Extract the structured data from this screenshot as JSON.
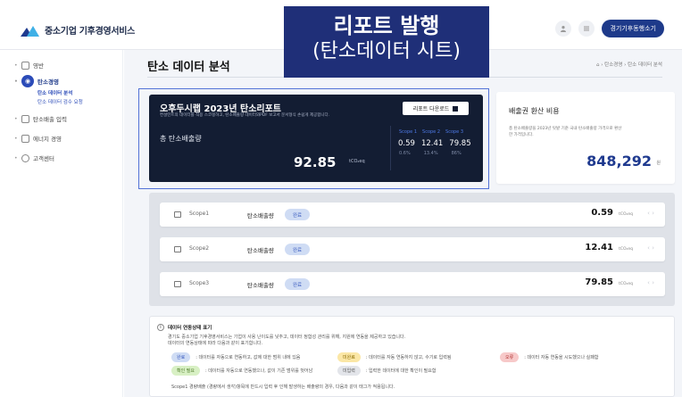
{
  "app": {
    "logo_text": "중소기업 기후경영서비스",
    "login_label": "경기기후동행소기"
  },
  "overlay": {
    "line1": "리포트 발행",
    "line2": "(탄소데이터 시트)"
  },
  "sidebar": {
    "items": [
      {
        "label": "영반"
      },
      {
        "label": "탄소경영"
      },
      {
        "label": "탄소배출 입력"
      },
      {
        "label": "에너지 경영"
      },
      {
        "label": "고객센터"
      }
    ],
    "subitems": [
      {
        "label": "탄소 데이터 분석"
      },
      {
        "label": "탄소 데이터 검수 요청"
      }
    ]
  },
  "page": {
    "title": "탄소 데이터 분석",
    "breadcrumb": "⌂ › 탄소경영 › 탄소 데이터 분석"
  },
  "report": {
    "title": "오후두시랩 2023년 탄소리포트",
    "description": "컨설턴트의 데이터를 적용 스코핑하고, 탄소배출량 데이터와PDF 보고서 문서형식 손쉽게 제공합니다.",
    "download_label": "리포트 다운로드",
    "total_label": "총 탄소배출량",
    "total_value": "92.85",
    "total_unit": "tCO₂eq",
    "scope_heads": [
      "Scope 1",
      "Scope 2",
      "Scope 3"
    ],
    "scope_values": [
      "0.59",
      "12.41",
      "79.85"
    ],
    "scope_pcts": [
      "0.6%",
      "13.4%",
      "86%"
    ]
  },
  "conversion": {
    "title": "배출권 환산 비용",
    "description": "총 탄소배출량을 2023년 탓밭 기준 국내 탄소배출량 가격으로 환산한 가격입니다.",
    "value": "848,292",
    "unit": "원"
  },
  "scopes": [
    {
      "name": "Scope1",
      "metric": "탄소배출량",
      "badge": "완료",
      "value": "0.59",
      "unit": "tCO₂eq"
    },
    {
      "name": "Scope2",
      "metric": "탄소배출량",
      "badge": "완료",
      "value": "12.41",
      "unit": "tCO₂eq"
    },
    {
      "name": "Scope3",
      "metric": "탄소배출량",
      "badge": "완료",
      "value": "79.85",
      "unit": "tCO₂eq"
    }
  ],
  "notes": {
    "title": "데이터 연동상태 표기",
    "line1": "경기도 중소기업 기후경영서비스는 기업이 사용 난이도를 낮추고, 데이터 정합성 관리를 위해, 지원에 연동을 제공하고 있습니다.",
    "line2": "데이터의 연동상태에 따라 다음과 같이 표기합니다.",
    "legend": [
      {
        "chip": "완료",
        "text": ": 데이터를 자동으로 연동하고, 값에 대한 범위 내에 있음",
        "color": "blue"
      },
      {
        "chip": "미완료",
        "text": ": 데이터를 자동 연동하지 않고, 수기로 입력됨",
        "color": "yellow"
      },
      {
        "chip": "오류",
        "text": ": 데이터 자동 연동을 시도했으나 실패함",
        "color": "red"
      },
      {
        "chip": "확인 필요",
        "text": ": 데이터를 자동으로 연동했으나, 값이 기존 범위를 벗어남",
        "color": "green"
      },
      {
        "chip": "미입력",
        "text": ": 입력한 데이터에 대한 확인이 필요함",
        "color": "gray"
      }
    ],
    "footer": "Scope1 경량배출 (경량에서 생각)항목에 반드시 입력 후 인해 발생하는 배출량의 경우, 다음과 같이 태그가 적용됩니다."
  }
}
